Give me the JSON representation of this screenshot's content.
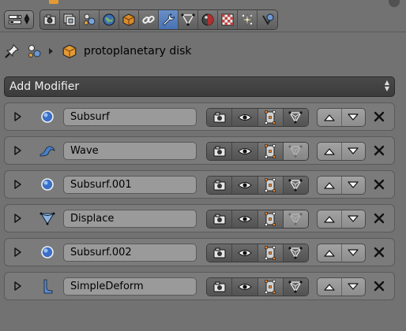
{
  "tabs": [
    {
      "name": "render-tab",
      "icon": "camera-icon"
    },
    {
      "name": "render-layers-tab",
      "icon": "render-layers-icon"
    },
    {
      "name": "scene-tab",
      "icon": "scene-icon"
    },
    {
      "name": "world-tab",
      "icon": "world-icon"
    },
    {
      "name": "object-tab",
      "icon": "object-cube-icon"
    },
    {
      "name": "constraints-tab",
      "icon": "chain-link-icon"
    },
    {
      "name": "modifiers-tab",
      "icon": "wrench-icon",
      "active": true
    },
    {
      "name": "data-tab",
      "icon": "mesh-data-icon"
    },
    {
      "name": "material-tab",
      "icon": "material-sphere-icon"
    },
    {
      "name": "texture-tab",
      "icon": "checker-texture-icon"
    },
    {
      "name": "particles-tab",
      "icon": "particles-icon"
    },
    {
      "name": "physics-tab",
      "icon": "physics-icon"
    }
  ],
  "breadcrumb": {
    "object_name": "protoplanetary disk"
  },
  "add_modifier": {
    "label": "Add Modifier"
  },
  "modifiers": [
    {
      "name": "Subsurf",
      "type_icon": "subsurf-icon",
      "editmode": true
    },
    {
      "name": "Wave",
      "type_icon": "wave-icon",
      "editmode": false
    },
    {
      "name": "Subsurf.001",
      "type_icon": "subsurf-icon",
      "editmode": true
    },
    {
      "name": "Displace",
      "type_icon": "displace-icon",
      "editmode": false
    },
    {
      "name": "Subsurf.002",
      "type_icon": "subsurf-icon",
      "editmode": true
    },
    {
      "name": "SimpleDeform",
      "type_icon": "simpledeform-icon",
      "editmode": true
    }
  ],
  "colors": {
    "panel_bg": "#727272",
    "active_tab": "#5680c2",
    "object_orange": "#e39a35"
  }
}
